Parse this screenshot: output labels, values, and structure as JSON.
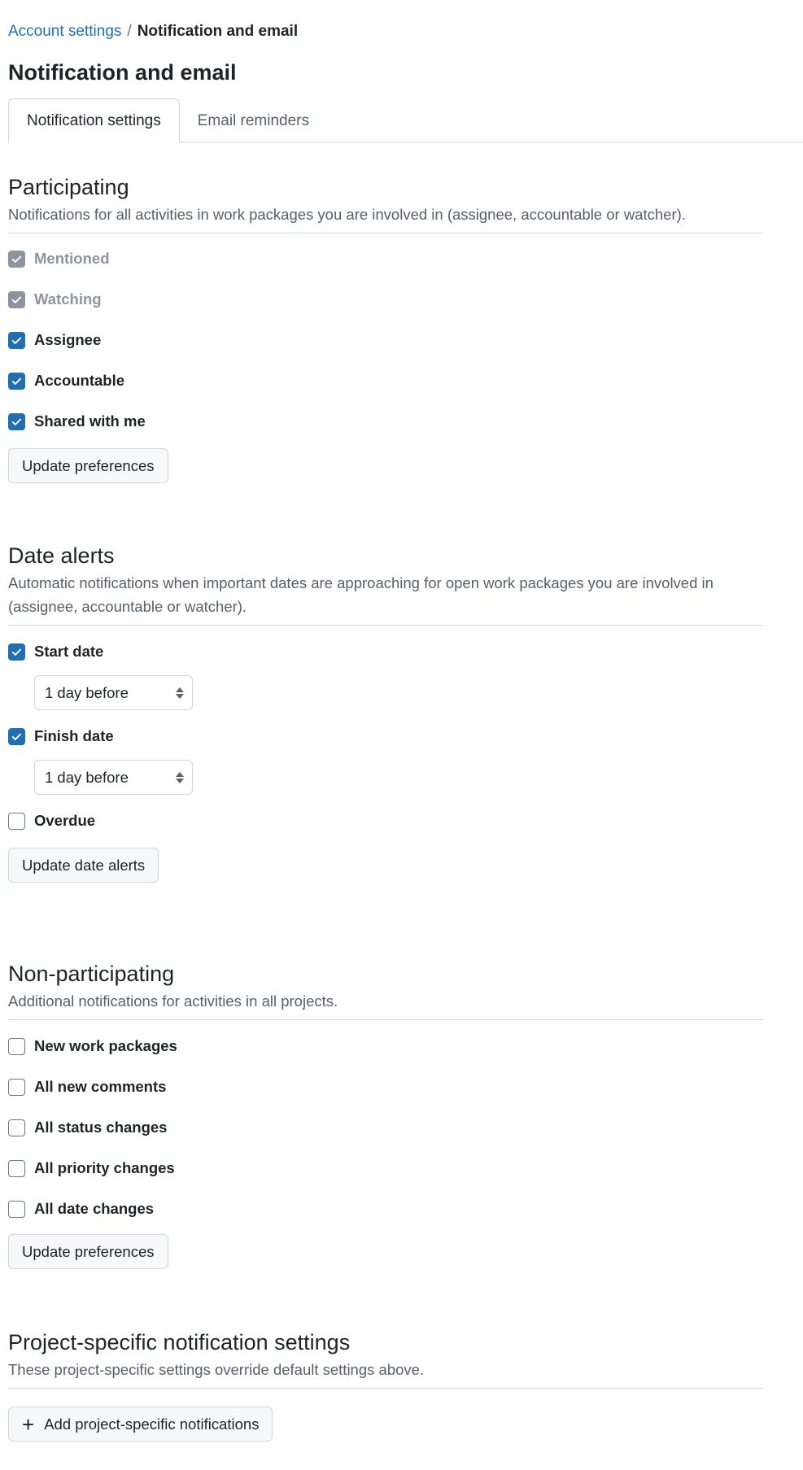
{
  "breadcrumb": {
    "parent": "Account settings",
    "separator": "/",
    "current": "Notification and email"
  },
  "page_title": "Notification and email",
  "tabs": [
    {
      "label": "Notification settings",
      "active": true
    },
    {
      "label": "Email reminders",
      "active": false
    }
  ],
  "participating": {
    "title": "Participating",
    "description": "Notifications for all activities in work packages you are involved in (assignee, accountable or watcher).",
    "items": [
      {
        "label": "Mentioned",
        "checked": true,
        "disabled": true
      },
      {
        "label": "Watching",
        "checked": true,
        "disabled": true
      },
      {
        "label": "Assignee",
        "checked": true,
        "disabled": false
      },
      {
        "label": "Accountable",
        "checked": true,
        "disabled": false
      },
      {
        "label": "Shared with me",
        "checked": true,
        "disabled": false
      }
    ],
    "button": "Update preferences"
  },
  "date_alerts": {
    "title": "Date alerts",
    "description": "Automatic notifications when important dates are approaching for open work packages you are involved in (assignee, accountable or watcher).",
    "start_date": {
      "label": "Start date",
      "checked": true,
      "select_value": "1 day before"
    },
    "finish_date": {
      "label": "Finish date",
      "checked": true,
      "select_value": "1 day before"
    },
    "overdue": {
      "label": "Overdue",
      "checked": false
    },
    "button": "Update date alerts"
  },
  "non_participating": {
    "title": "Non-participating",
    "description": "Additional notifications for activities in all projects.",
    "items": [
      {
        "label": "New work packages",
        "checked": false
      },
      {
        "label": "All new comments",
        "checked": false
      },
      {
        "label": "All status changes",
        "checked": false
      },
      {
        "label": "All priority changes",
        "checked": false
      },
      {
        "label": "All date changes",
        "checked": false
      }
    ],
    "button": "Update preferences"
  },
  "project_specific": {
    "title": "Project-specific notification settings",
    "description": "These project-specific settings override default settings above.",
    "button": "Add project-specific notifications"
  },
  "colors": {
    "accent": "#1f6fb2",
    "border": "#d0d7de",
    "muted_text": "#57606a"
  }
}
